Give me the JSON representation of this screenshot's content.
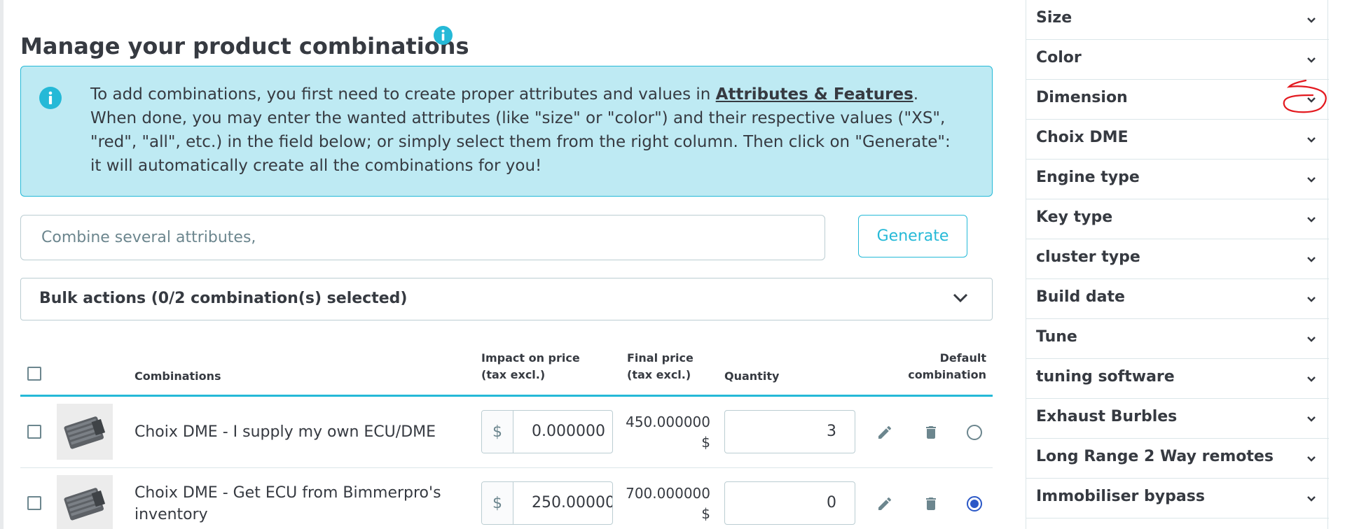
{
  "page_title": "Manage your product combinations",
  "info_alert": {
    "line1_prefix": "To add combinations, you first need to create proper attributes and values in ",
    "link_text": "Attributes & Features",
    "line1_suffix": ".",
    "body": "When done, you may enter the wanted attributes (like \"size\" or \"color\") and their respective values (\"XS\", \"red\", \"all\", etc.) in the field below; or simply select them from the right column. Then click on \"Generate\": it will automatically create all the combinations for you!"
  },
  "combine_input": {
    "placeholder": "Combine several attributes,",
    "value": ""
  },
  "generate_label": "Generate",
  "bulk_actions_label": "Bulk actions (0/2 combination(s) selected)",
  "table": {
    "headers": {
      "combinations": "Combinations",
      "impact_on_price": "Impact on price (tax excl.)",
      "final_price": "Final price (tax excl.)",
      "quantity": "Quantity",
      "default_combination": "Default combination"
    },
    "currency_symbol": "$",
    "rows": [
      {
        "name": "Choix DME - I supply my own ECU/DME",
        "impact": "0.000000",
        "final_price": "450.000000 $",
        "quantity": "3",
        "is_default": false
      },
      {
        "name": "Choix DME - Get ECU from Bimmerpro's inventory",
        "impact": "250.000000",
        "final_price": "700.000000 $",
        "quantity": "0",
        "is_default": true
      }
    ]
  },
  "attribute_groups": [
    "Size",
    "Color",
    "Dimension",
    "Choix DME",
    "Engine type",
    "Key type",
    "cluster type",
    "Build date",
    "Tune",
    "tuning software",
    "Exhaust Burbles",
    "Long Range 2 Way remotes",
    "Immobiliser bypass"
  ],
  "colors": {
    "accent": "#25b9d7",
    "alert_background": "#beeaf3",
    "text": "#363a41",
    "radio_selected": "#2b58c7",
    "annotation": "#e3191f"
  },
  "icons": [
    "info-icon",
    "chevron-down-icon",
    "edit-pencil-icon",
    "trash-icon",
    "radio-icon"
  ]
}
